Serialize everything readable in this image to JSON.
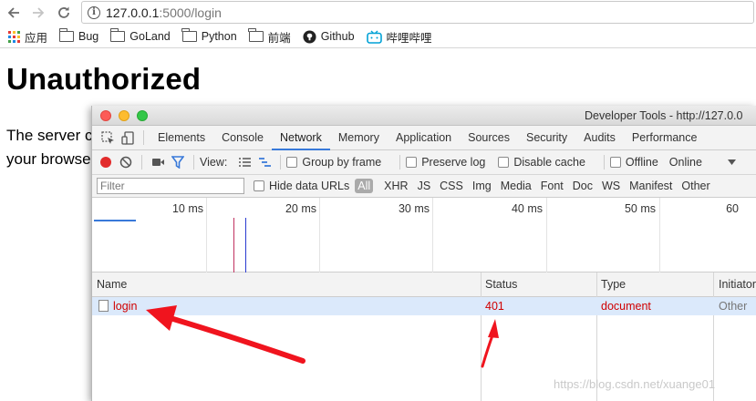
{
  "browser": {
    "url_host": "127.0.0.1",
    "url_path": ":5000/login",
    "bookmarks": [
      {
        "label": "应用",
        "icon": "apps-grid-icon"
      },
      {
        "label": "Bug",
        "icon": "folder-icon"
      },
      {
        "label": "GoLand",
        "icon": "folder-icon"
      },
      {
        "label": "Python",
        "icon": "folder-icon"
      },
      {
        "label": "前端",
        "icon": "folder-icon"
      },
      {
        "label": "Github",
        "icon": "github-icon"
      },
      {
        "label": "哔哩哔哩",
        "icon": "bilibili-icon"
      }
    ]
  },
  "page": {
    "title": "Unauthorized",
    "text_line1": "The server c",
    "text_line2": "your browse"
  },
  "devtools": {
    "title": "Developer Tools - http://127.0.0",
    "tabs": [
      "Elements",
      "Console",
      "Network",
      "Memory",
      "Application",
      "Sources",
      "Security",
      "Audits",
      "Performance"
    ],
    "active_tab": "Network",
    "toolbar": {
      "view_label": "View:",
      "group_by_frame": "Group by frame",
      "preserve_log": "Preserve log",
      "disable_cache": "Disable cache",
      "offline": "Offline",
      "throttling": "Online"
    },
    "filter": {
      "placeholder": "Filter",
      "hide_data_urls": "Hide data URLs",
      "types": [
        "All",
        "XHR",
        "JS",
        "CSS",
        "Img",
        "Media",
        "Font",
        "Doc",
        "WS",
        "Manifest",
        "Other"
      ]
    },
    "timeline_ticks": [
      "10 ms",
      "20 ms",
      "30 ms",
      "40 ms",
      "50 ms",
      "60"
    ],
    "columns": [
      "Name",
      "Status",
      "Type",
      "Initiator"
    ],
    "rows": [
      {
        "name": "login",
        "status": "401",
        "type": "document",
        "initiator": "Other"
      }
    ]
  },
  "watermark": "https://blog.csdn.net/xuange01",
  "colors": {
    "accent": "#3879d9",
    "error_text": "#d00000",
    "selected_row": "#dbe9fb",
    "annotation_arrow": "#f0141e"
  }
}
